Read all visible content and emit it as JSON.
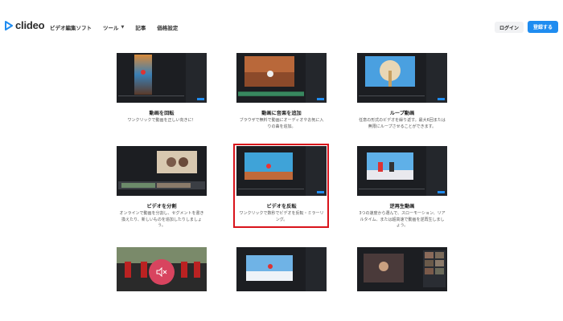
{
  "header": {
    "logo_text": "clideo",
    "nav": [
      {
        "label": "ビデオ編集ソフト"
      },
      {
        "label": "ツール",
        "has_dropdown": true
      },
      {
        "label": "記事"
      },
      {
        "label": "価格設定"
      }
    ],
    "login_label": "ログイン",
    "signup_label": "登録する"
  },
  "colors": {
    "brand_blue": "#1f8cf0",
    "highlight_red": "#d9131b",
    "mute_pink": "#d8445f"
  },
  "cards": [
    {
      "title": "動画を回転",
      "desc": "ワンクリックで動画を正しい向きに！"
    },
    {
      "title": "動画に音楽を追加",
      "desc": "ブラウザで無料で動画にオーディオやお気に入りの曲を追加。"
    },
    {
      "title": "ループ動画",
      "desc": "任意の形式のビデオを繰り返す。最大6回または無限にループさせることができます。"
    },
    {
      "title": "ビデオを分割",
      "desc": "オンラインで動画を分割し、セグメントを書き換えたり、新しいものを追加したりしましょう。"
    },
    {
      "title": "ビデオを反転",
      "desc": "ワンクリックで数秒でビデオを反転・ミラーリング。"
    },
    {
      "title": "逆再生動画",
      "desc": "3つの速度から選んで、スローモーション、リアルタイム、または超高速で動画を逆再生しましょう。"
    }
  ],
  "mute_icon": "speaker-mute-icon"
}
